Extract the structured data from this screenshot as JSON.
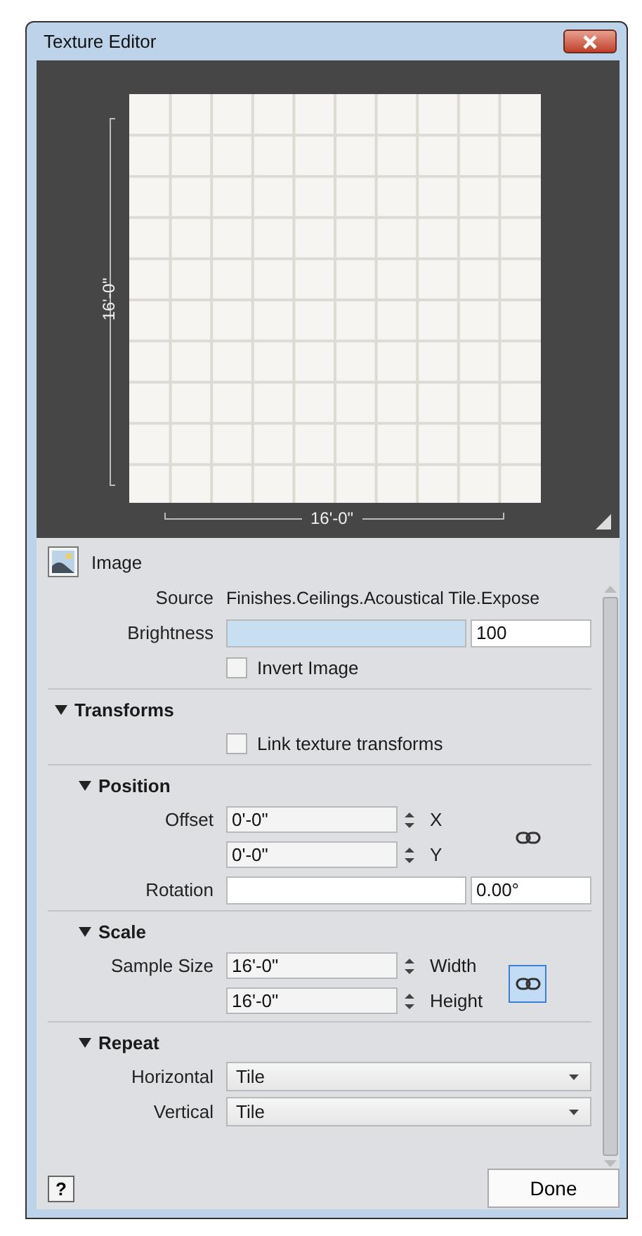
{
  "window": {
    "title": "Texture Editor"
  },
  "preview": {
    "width_label": "16'-0\"",
    "height_label": "16'-0\""
  },
  "image": {
    "title": "Image",
    "source": {
      "label": "Source",
      "value": "Finishes.Ceilings.Acoustical Tile.Expose"
    },
    "brightness": {
      "label": "Brightness",
      "level": 1,
      "value": "100"
    },
    "invert": {
      "label": "Invert Image",
      "checked": false
    }
  },
  "transforms": {
    "title": "Transforms",
    "expanded": true,
    "link": {
      "label": "Link texture transforms",
      "checked": false
    },
    "sections": [
      {
        "title": "Position",
        "expanded": true,
        "pair": {
          "label": "Offset",
          "fields": [
            {
              "value": "0'-0\"",
              "axis": "X"
            },
            {
              "value": "0'-0\"",
              "axis": "Y"
            }
          ],
          "linked": false
        },
        "rotation": {
          "label": "Rotation",
          "level": 0,
          "value": "0.00°"
        }
      },
      {
        "title": "Scale",
        "expanded": true,
        "pair": {
          "label": "Sample Size",
          "fields": [
            {
              "value": "16'-0\"",
              "axis": "Width"
            },
            {
              "value": "16'-0\"",
              "axis": "Height"
            }
          ],
          "linked": true
        }
      },
      {
        "title": "Repeat",
        "expanded": true,
        "selects": [
          {
            "label": "Horizontal",
            "value": "Tile"
          },
          {
            "label": "Vertical",
            "value": "Tile"
          }
        ]
      }
    ]
  },
  "footer": {
    "help": "?",
    "done": "Done"
  }
}
